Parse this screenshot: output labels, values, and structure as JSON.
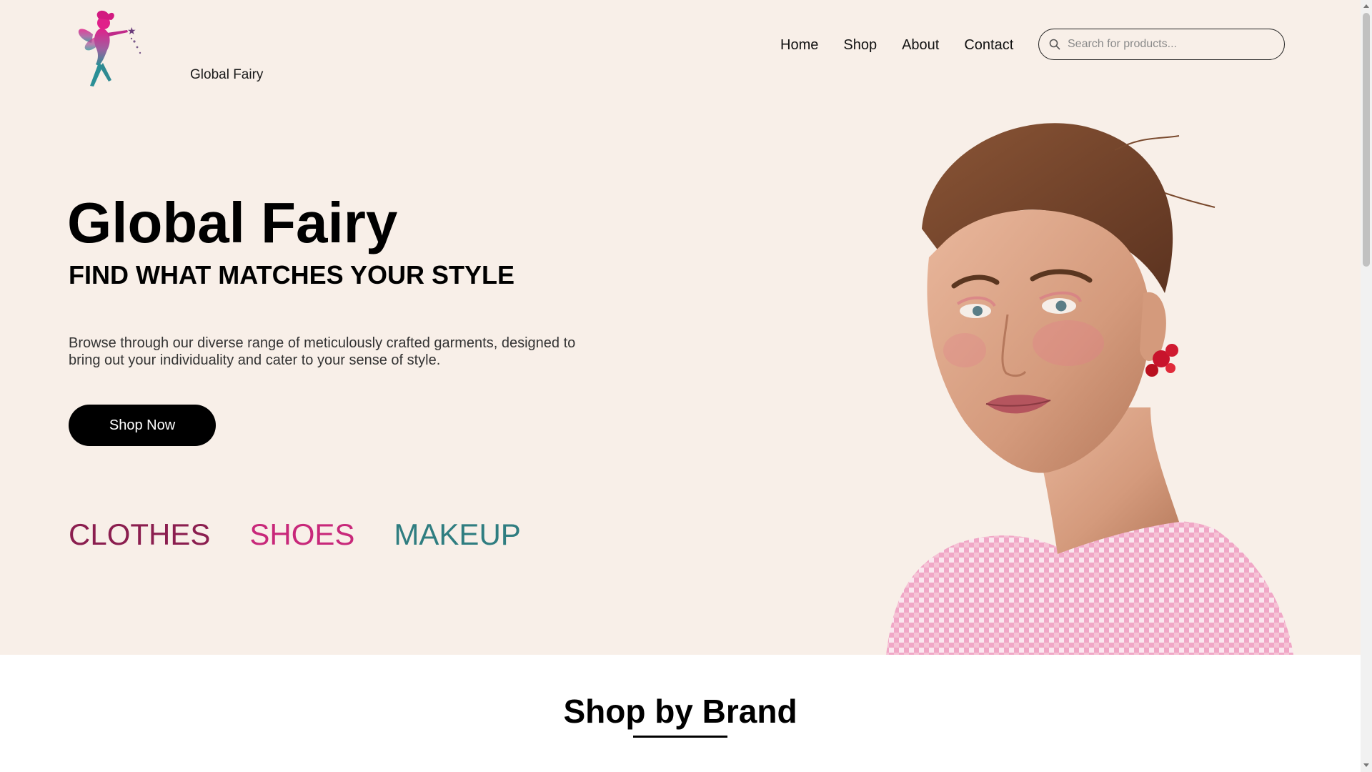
{
  "brand": {
    "logo_text": "Global Fairy"
  },
  "nav": {
    "items": [
      {
        "label": "Home"
      },
      {
        "label": "Shop"
      },
      {
        "label": "About"
      },
      {
        "label": "Contact"
      }
    ]
  },
  "search": {
    "placeholder": "Search for products...",
    "value": ""
  },
  "hero": {
    "title": "Global Fairy",
    "subtitle": "FIND WHAT MATCHES YOUR STYLE",
    "description": "Browse through our diverse range of meticulously crafted garments, designed to bring out your individuality and cater to your sense of style.",
    "cta_label": "Shop Now",
    "categories": [
      {
        "label": "CLOTHES",
        "color": "#8b1e4f"
      },
      {
        "label": "SHOES",
        "color": "#c8287a"
      },
      {
        "label": "MAKEUP",
        "color": "#2f7d80"
      }
    ]
  },
  "brand_section": {
    "title": "Shop by Brand"
  },
  "colors": {
    "hero_background": "#f8efe8",
    "accent_pink": "#c8287a",
    "accent_teal": "#2f7d80"
  }
}
